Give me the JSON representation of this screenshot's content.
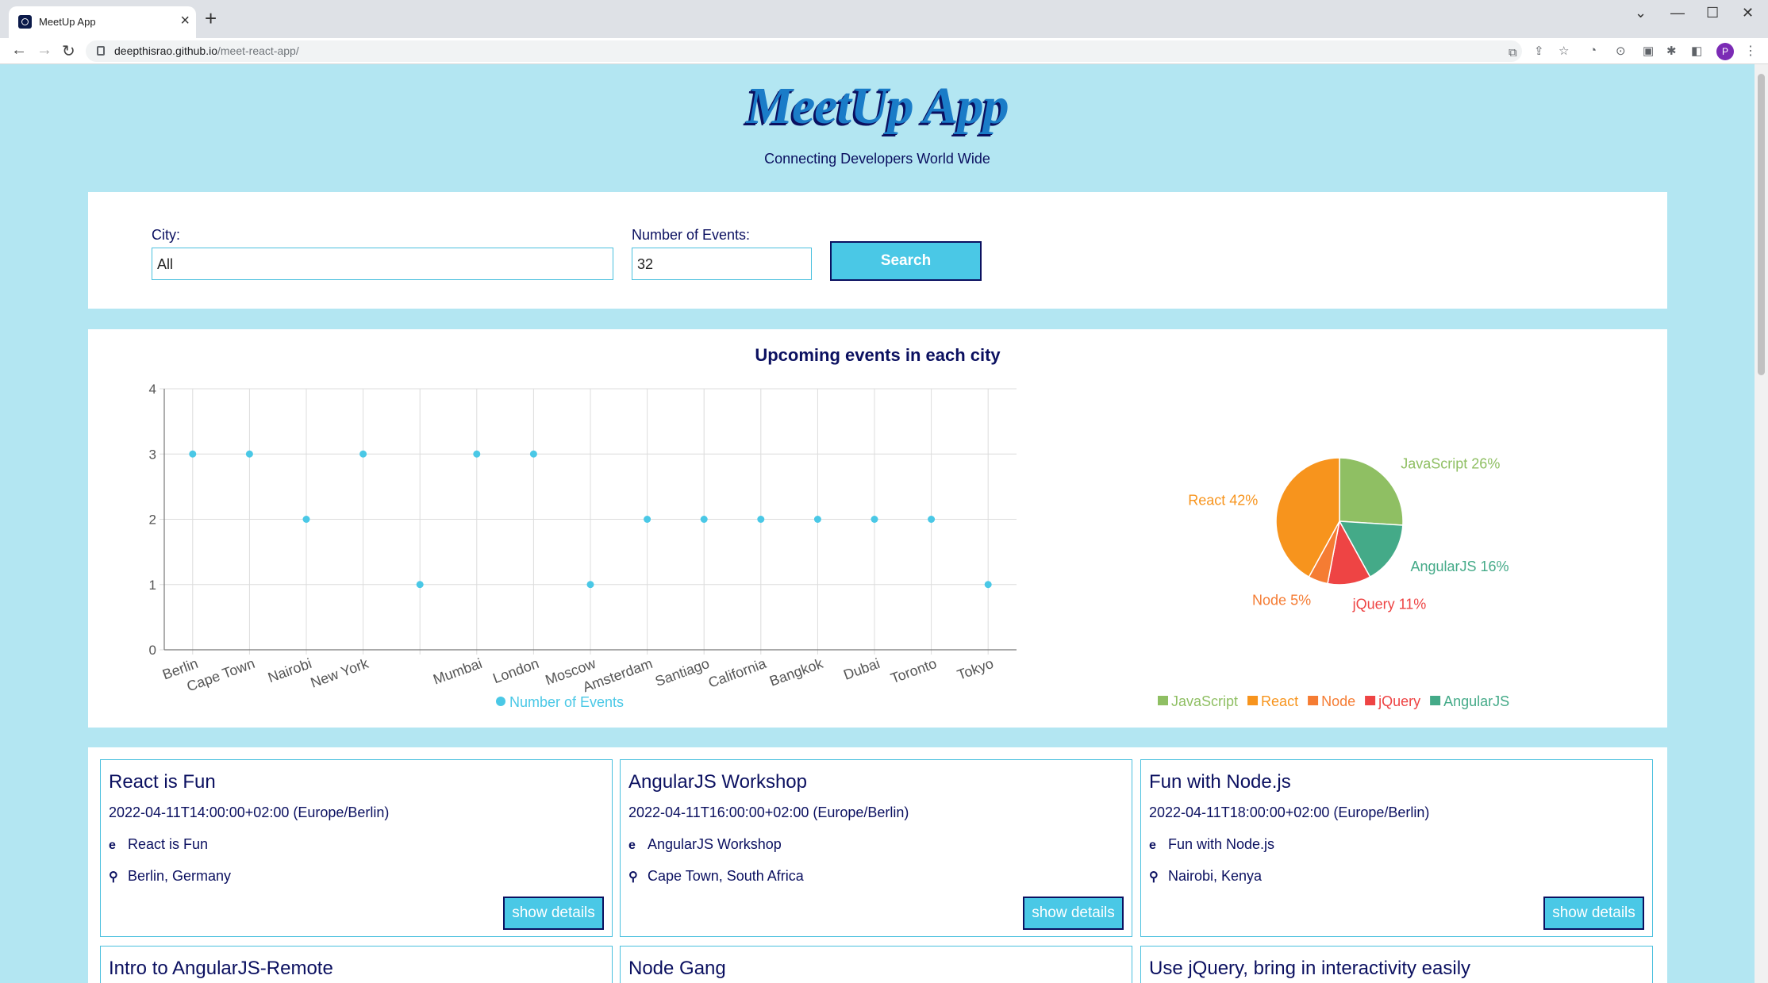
{
  "browser": {
    "tab_title": "MeetUp App",
    "tab_close": "×",
    "new_tab": "+",
    "url_host": "deepthisrao.github.io",
    "url_path": "/meet-react-app/",
    "profile_initial": "P"
  },
  "header": {
    "title": "MeetUp App",
    "subtitle": "Connecting Developers World Wide"
  },
  "search": {
    "city_label": "City:",
    "city_value": "All",
    "count_label": "Number of Events:",
    "count_value": "32",
    "button_label": "Search"
  },
  "charts": {
    "title": "Upcoming events in each city"
  },
  "chart_data": [
    {
      "type": "scatter",
      "categories": [
        "Berlin",
        "Cape Town",
        "Nairobi",
        "New York",
        "",
        "Mumbai",
        "London",
        "Moscow",
        "Amsterdam",
        "Santiago",
        "California",
        "Bangkok",
        "Dubai",
        "Toronto",
        "Tokyo"
      ],
      "values": [
        3,
        3,
        2,
        3,
        1,
        3,
        3,
        1,
        2,
        2,
        2,
        2,
        2,
        2,
        1
      ],
      "ylim": [
        0,
        4
      ],
      "yticks": [
        0,
        1,
        2,
        3,
        4
      ],
      "grid": true,
      "series": [
        {
          "name": "Number of Events",
          "color": "#4ac8e6"
        }
      ],
      "legend": "bottom"
    },
    {
      "type": "pie",
      "labels": [
        "JavaScript",
        "AngularJS",
        "jQuery",
        "Node",
        "React"
      ],
      "values": [
        26,
        16,
        11,
        5,
        42
      ],
      "slice_labels": [
        "JavaScript 26%",
        "AngularJS 16%",
        "jQuery 11%",
        "Node 5%",
        "React 42%"
      ],
      "colors": [
        "#8fbf63",
        "#44aa88",
        "#ee4444",
        "#f57c33",
        "#f7941d"
      ],
      "legend_order": [
        "JavaScript",
        "React",
        "Node",
        "jQuery",
        "AngularJS"
      ],
      "legend_colors": [
        "#8fbf63",
        "#f7941d",
        "#f57c33",
        "#ee4444",
        "#44aa88"
      ],
      "legend": "bottom"
    }
  ],
  "events": [
    {
      "title": "React is Fun",
      "date": "2022-04-11T14:00:00+02:00 (Europe/Berlin)",
      "summary": "React is Fun",
      "location": "Berlin, Germany",
      "button": "show details"
    },
    {
      "title": "AngularJS Workshop",
      "date": "2022-04-11T16:00:00+02:00 (Europe/Berlin)",
      "summary": "AngularJS Workshop",
      "location": "Cape Town, South Africa",
      "button": "show details"
    },
    {
      "title": "Fun with Node.js",
      "date": "2022-04-11T18:00:00+02:00 (Europe/Berlin)",
      "summary": "Fun with Node.js",
      "location": "Nairobi, Kenya",
      "button": "show details"
    },
    {
      "title": "Intro to AngularJS-Remote"
    },
    {
      "title": "Node Gang"
    },
    {
      "title": "Use jQuery, bring in interactivity easily"
    }
  ]
}
